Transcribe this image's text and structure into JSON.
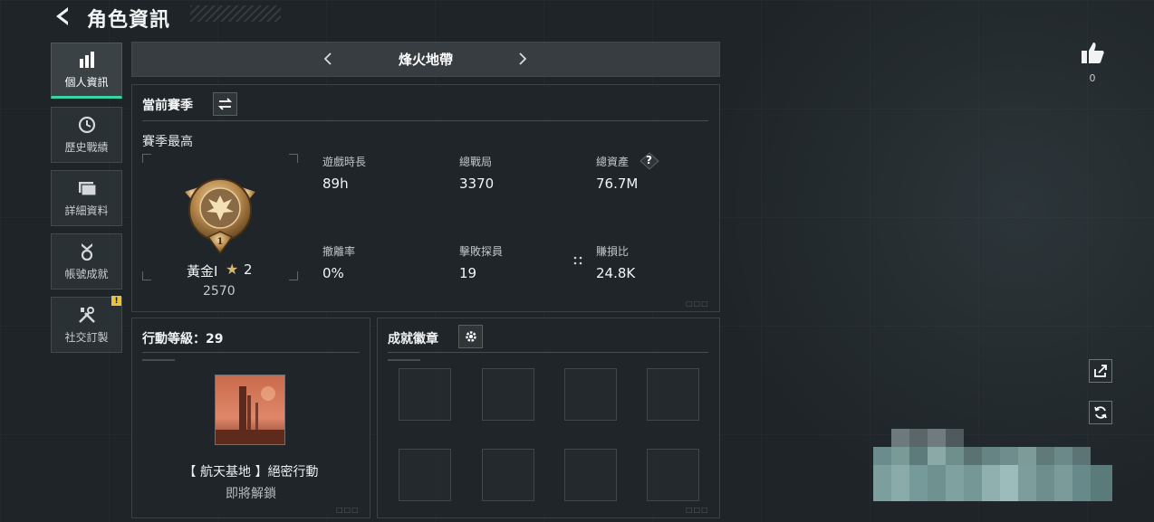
{
  "header": {
    "title": "角色資訊",
    "back_icon": "chevron-left-icon"
  },
  "sidebar": {
    "items": [
      {
        "label": "個人資訊",
        "icon": "bar-chart-icon",
        "active": true
      },
      {
        "label": "歷史戰績",
        "icon": "history-clock-icon",
        "active": false
      },
      {
        "label": "詳細資料",
        "icon": "folder-icon",
        "active": false
      },
      {
        "label": "帳號成就",
        "icon": "medal-icon",
        "active": false
      },
      {
        "label": "社交訂製",
        "icon": "tools-icon",
        "active": false,
        "badge": "!"
      }
    ]
  },
  "mode_bar": {
    "name": "烽火地帶"
  },
  "season": {
    "title": "當前賽季",
    "subtitle": "賽季最高",
    "rank_name": "黃金I",
    "rank_stars": "2",
    "rank_score": "2570",
    "rank_medal_level": "1",
    "stats": [
      {
        "label": "遊戲時長",
        "value": "89h"
      },
      {
        "label": "總戰局",
        "value": "3370"
      },
      {
        "label": "總資產",
        "value": "76.7M",
        "help": "?"
      },
      {
        "label": "撤離率",
        "value": "0%"
      },
      {
        "label": "擊敗探員",
        "value": "19"
      },
      {
        "label": "賺損比",
        "value": "24.8K"
      }
    ]
  },
  "operation": {
    "title": "行動等級：29",
    "reward_name": "【 航天基地 】絕密行動",
    "reward_status": "即將解鎖"
  },
  "achievements": {
    "title": "成就徽章",
    "slots": 8
  },
  "right_rail": {
    "like_count": "0"
  },
  "colors": {
    "accent_active": "#39d4a6",
    "badge_warning": "#e9c23a",
    "medal_gold": "#c99a58"
  }
}
